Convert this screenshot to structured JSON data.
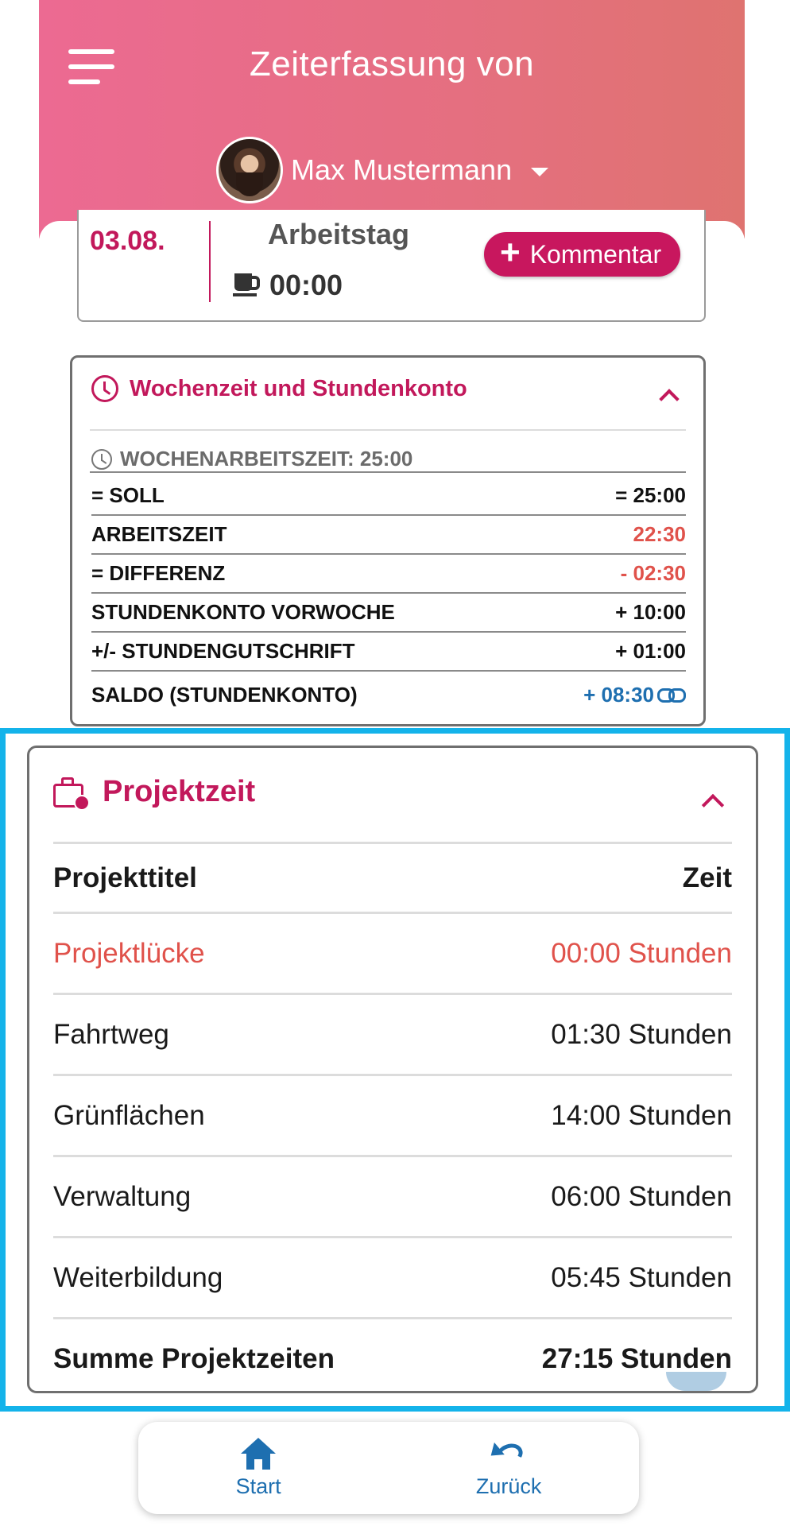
{
  "header": {
    "title": "Zeiterfassung von",
    "user_name": "Max Mustermann"
  },
  "day": {
    "date": "03.08.",
    "type": "Arbeitstag",
    "break_time": "00:00",
    "comment_button": "Kommentar"
  },
  "week": {
    "title": "Wochenzeit und Stundenkonto",
    "subtitle": "WOCHENARBEITSZEIT: 25:00",
    "rows": [
      {
        "label": "= SOLL",
        "value": "= 25:00"
      },
      {
        "label": "ARBEITSZEIT",
        "value": "22:30"
      },
      {
        "label": "= DIFFERENZ",
        "value": "- 02:30"
      },
      {
        "label": "STUNDENKONTO VORWOCHE",
        "value": "+ 10:00"
      },
      {
        "label": "+/- STUNDENGUTSCHRIFT",
        "value": "+ 01:00"
      },
      {
        "label": "SALDO (STUNDENKONTO)",
        "value": "+ 08:30"
      }
    ]
  },
  "project": {
    "title": "Projektzeit",
    "col_title": "Projekttitel",
    "col_time": "Zeit",
    "rows": [
      {
        "name": "Projektlücke",
        "time": "00:00 Stunden"
      },
      {
        "name": "Fahrtweg",
        "time": "01:30 Stunden"
      },
      {
        "name": "Grünflächen",
        "time": "14:00 Stunden"
      },
      {
        "name": "Verwaltung",
        "time": "06:00 Stunden"
      },
      {
        "name": "Weiterbildung",
        "time": "05:45 Stunden"
      }
    ],
    "sum_label": "Summe Projektzeiten",
    "sum_value": "27:15 Stunden"
  },
  "nav": {
    "start": "Start",
    "back": "Zurück"
  },
  "colors": {
    "accent": "#c2185b",
    "negative": "#e0524b",
    "link": "#1e6fb0",
    "highlight": "#14b3ea"
  }
}
